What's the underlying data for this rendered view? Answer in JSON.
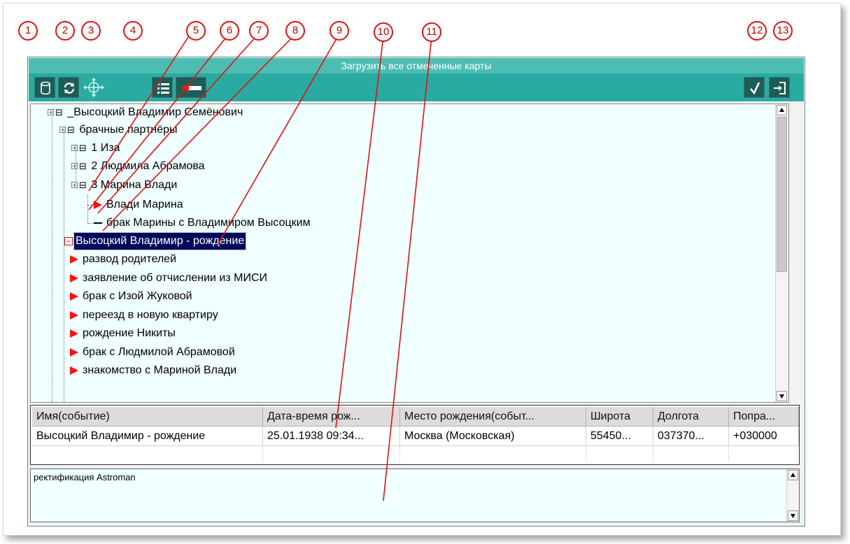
{
  "window": {
    "title": "Загрузить все отмеченные карты"
  },
  "toolbar": {
    "icons": [
      "database-icon",
      "refresh-icon",
      "move-crosshair-icon",
      "list-icon",
      "flag-icon",
      "checkmark-icon",
      "exit-icon"
    ],
    "accent_color": "#2aaba1"
  },
  "tree": {
    "nodes": [
      {
        "label": "_Высоцкий Владимир Семёнович"
      },
      {
        "label": "брачные партнёры"
      },
      {
        "label": "1 Иза"
      },
      {
        "label": "2 Людмила Абрамова"
      },
      {
        "label": "3 Марина Влади"
      },
      {
        "label": "Влади Марина"
      },
      {
        "label": "брак Марины с Владимиром Высоцким"
      },
      {
        "label": "Высоцкий Владимир - рождение"
      },
      {
        "label": "развод родителей"
      },
      {
        "label": "заявление об отчислении из МИСИ"
      },
      {
        "label": "брак с Изой Жуковой"
      },
      {
        "label": "переезд в новую квартиру"
      },
      {
        "label": "рождение Никиты"
      },
      {
        "label": "брак с Людмилой Абрамовой"
      },
      {
        "label": "знакомство с Мариной Влади"
      }
    ],
    "selected": "Высоцкий Владимир - рождение"
  },
  "grid": {
    "columns": [
      "Имя(событие)",
      "Дата-время рож...",
      "Место рождения(событ...",
      "Широта",
      "Долгота",
      "Попра..."
    ],
    "rows": [
      [
        "Высоцкий Владимир - рождение",
        "25.01.1938 09:34...",
        "Москва (Московская)",
        "55450...",
        "037370...",
        "+030000"
      ]
    ]
  },
  "notes": {
    "text": "ректификация Astroman"
  },
  "markers": [
    "1",
    "2",
    "3",
    "4",
    "5",
    "6",
    "7",
    "8",
    "9",
    "10",
    "11",
    "12",
    "13"
  ],
  "colors": {
    "marker": "#e51010",
    "selection": "#000a5a",
    "title_bar": "#4dbdb3"
  }
}
